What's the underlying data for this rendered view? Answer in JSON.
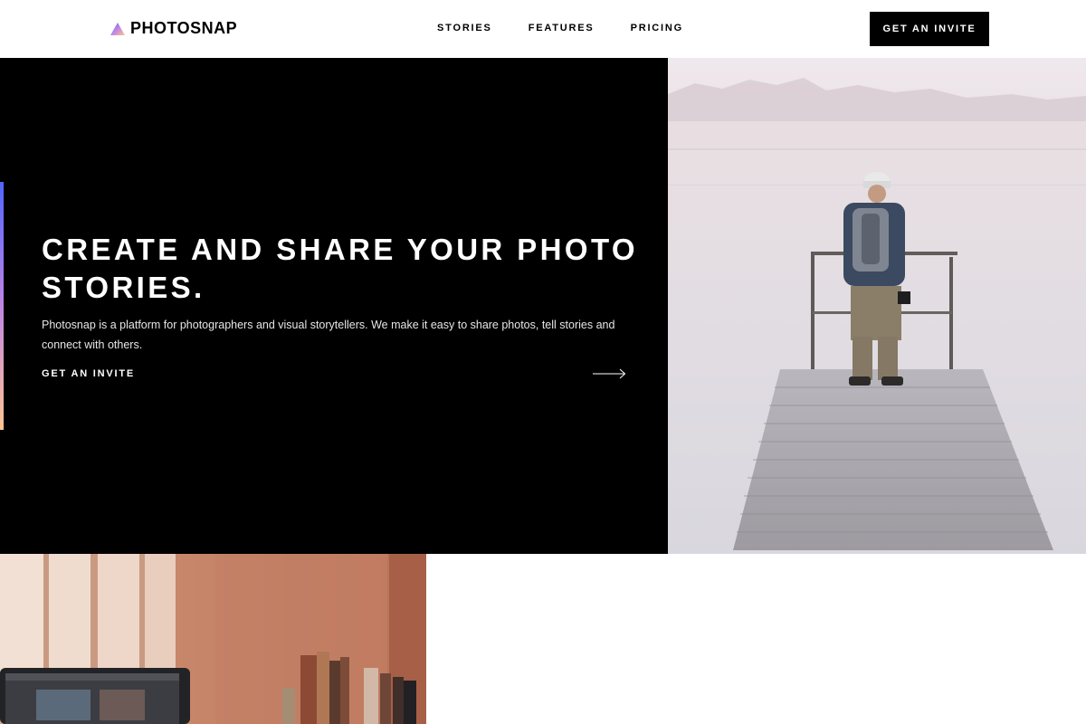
{
  "header": {
    "brand": "PHOTOSNAP",
    "nav": [
      "STORIES",
      "FEATURES",
      "PRICING"
    ],
    "cta_label": "GET AN INVITE"
  },
  "hero": {
    "title": "CREATE AND SHARE YOUR PHOTO STORIES.",
    "description": "Photosnap is a platform for photographers and visual storytellers. We make it easy to share photos, tell stories and connect with others.",
    "cta_label": "GET AN INVITE",
    "accent_gradient": [
      "#5165ff",
      "#bf85e3",
      "#ffc593"
    ]
  },
  "icons": {
    "logo": "triangle-gradient-icon",
    "cta": "arrow-right-icon"
  },
  "colors": {
    "hero_background": "#000000",
    "header_background": "#ffffff",
    "button_background": "#000000"
  }
}
